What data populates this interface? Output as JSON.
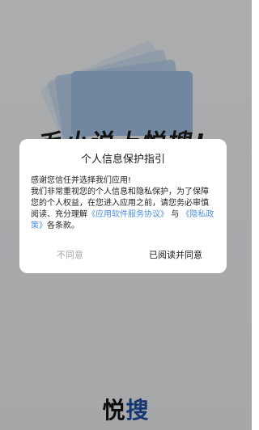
{
  "splash": {
    "slogan": "毛小说上悦搜!",
    "logo_text": "悦",
    "logo_accent": "搜"
  },
  "dialog": {
    "title": "个人信息保护指引",
    "greeting": "感谢您信任并选择我们应用!",
    "body_text": "我们非常重视您的个人信息和隐私保护，为了保障您的个人权益，在您进入应用之前，请您务必审慎阅读、充分理解",
    "link_service": "《应用软件服务协议》",
    "conjunction": "与",
    "link_privacy": "《隐私政策》",
    "suffix": "各条款。",
    "btn_disagree": "不同意",
    "btn_agree": "已阅读并同意"
  },
  "colors": {
    "link": "#4b8fe2",
    "disagree": "#a6a6a6",
    "logo_accent": "#1f4ea3"
  }
}
